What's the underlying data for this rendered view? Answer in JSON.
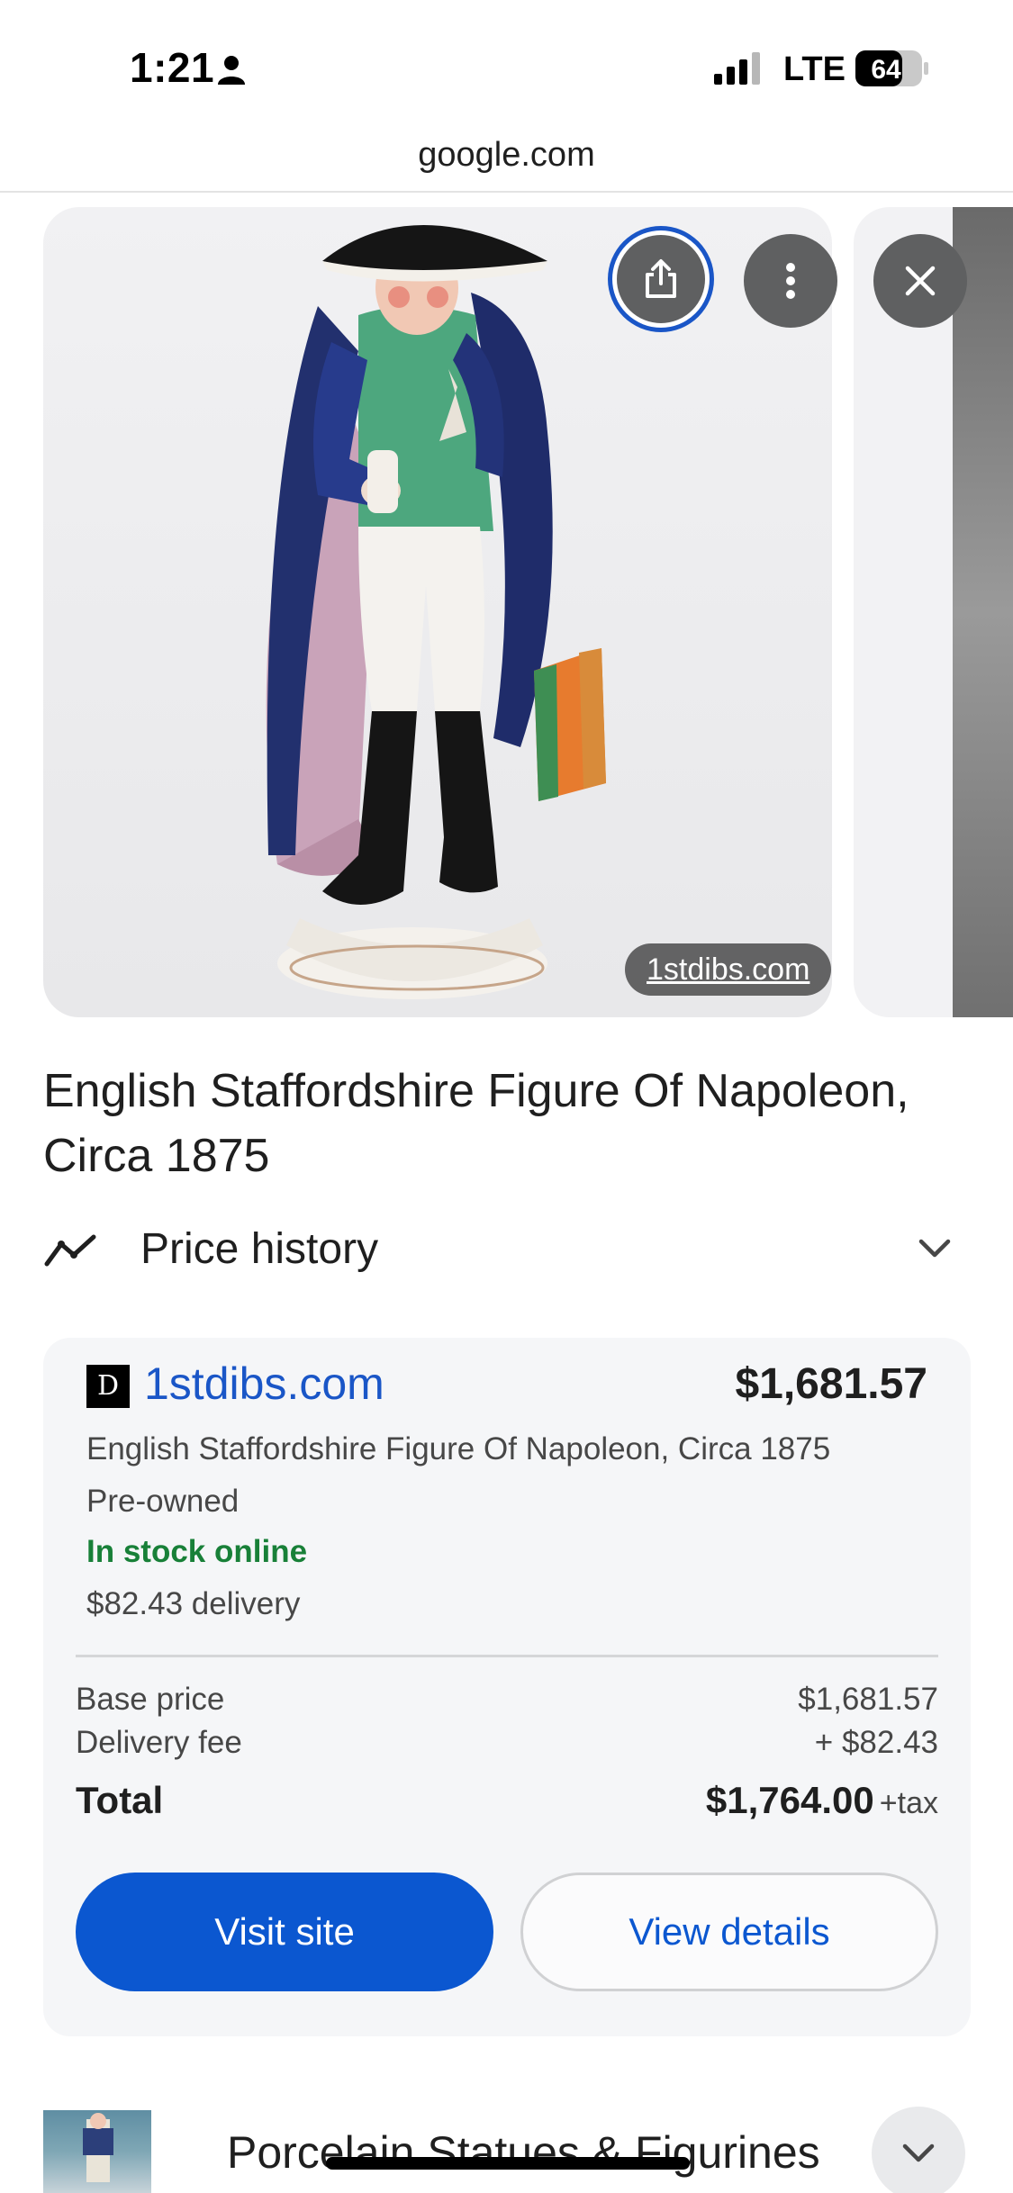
{
  "status_bar": {
    "time": "1:21",
    "network": "LTE",
    "battery": "64",
    "icons": [
      "person-icon",
      "signal-icon",
      "battery-icon"
    ]
  },
  "browser": {
    "url": "google.com"
  },
  "gallery": {
    "source_chip": "1stdibs.com",
    "buttons": [
      "share-icon",
      "more-vert-icon",
      "close-icon"
    ],
    "colors": {
      "share_ring": "#1a56c7",
      "button_bg": "#5f6061"
    }
  },
  "product": {
    "title": "English Staffordshire Figure Of Napoleon, Circa 1875"
  },
  "price_history": {
    "label": "Price history",
    "icon": "trend-icon"
  },
  "offer": {
    "merchant_logo": "D",
    "merchant": "1stdibs.com",
    "price": "$1,681.57",
    "description": "English Staffordshire Figure Of Napoleon, Circa 1875",
    "condition": "Pre-owned",
    "stock": "In stock online",
    "delivery": "$82.43 delivery",
    "base_price_label": "Base price",
    "base_price_value": "$1,681.57",
    "delivery_fee_label": "Delivery fee",
    "delivery_fee_value": "+ $82.43",
    "total_label": "Total",
    "total_value": "$1,764.00",
    "total_suffix": "+tax",
    "visit_button": "Visit site",
    "details_button": "View details",
    "colors": {
      "link": "#1a56c7",
      "stock": "#188038",
      "primary_button": "#0b57d0"
    }
  },
  "related": {
    "title": "Porcelain Statues & Figurines"
  }
}
